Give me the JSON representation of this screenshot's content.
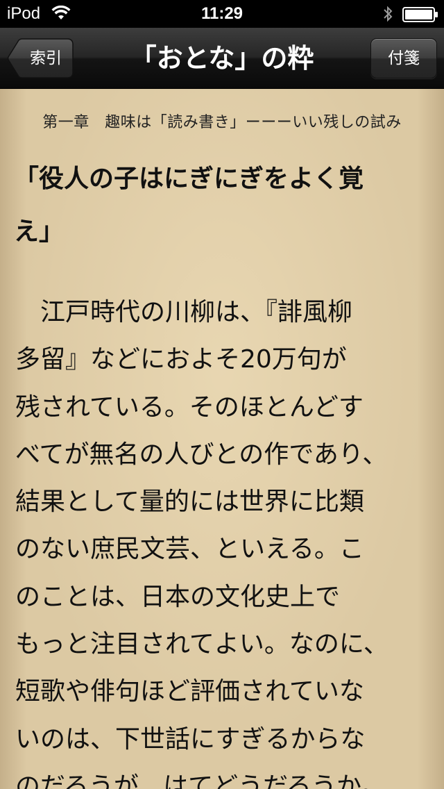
{
  "status_bar": {
    "carrier": "iPod",
    "time": "11:29",
    "icons": [
      "wifi-icon",
      "bluetooth-icon",
      "battery-icon"
    ]
  },
  "nav_bar": {
    "back_label": "索引",
    "title": "「おとな」の粋",
    "bookmark_label": "付箋"
  },
  "page": {
    "chapter_header": "第一章　趣味は「読み書き」ーーーいい残しの試み",
    "section_title_lines": [
      "「役人の子はにぎにぎをよく覚",
      "え」"
    ],
    "body_lines": [
      "　江戸時代の川柳は、『誹風柳",
      "多留』などにおよそ20万句が",
      "残されている。そのほとんどす",
      "べてが無名の人びとの作であり、",
      "結果として量的には世界に比類",
      "のない庶民文芸、といえる。こ",
      "のことは、日本の文化史上で",
      "もっと注目されてよい。なのに、",
      "短歌や俳句ほど評価されていな",
      "いのは、下世話にすぎるからな",
      "のだろうが、はてどうだろうか。"
    ]
  },
  "colors": {
    "paper": "#dcc9a3",
    "nav_bar": "#1a1a1a",
    "text": "#111111"
  }
}
